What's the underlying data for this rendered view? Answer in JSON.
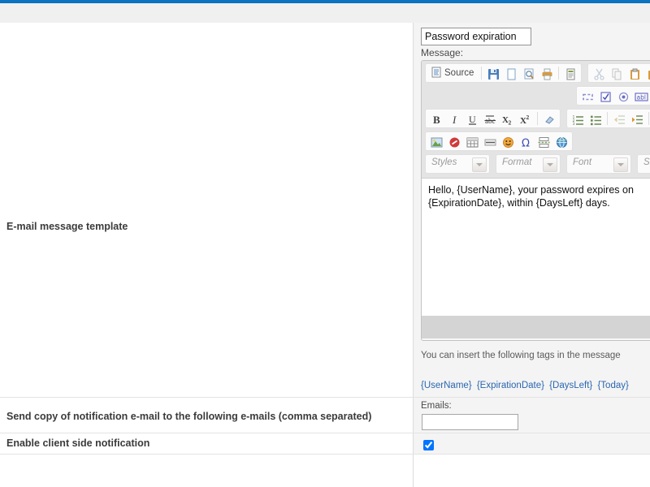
{
  "theme": {
    "accent_blue": "#0a73c2",
    "header_gray": "#f0f0f0",
    "panel_gray": "#f4f4f4",
    "link_blue": "#2a66b0",
    "label_text": "#3b3b3b"
  },
  "settings_rows": [
    {
      "label": "E-mail message template"
    },
    {
      "label": "Send copy of notification e-mail to the following e-mails (comma separated)"
    },
    {
      "label": "Enable client side notification"
    }
  ],
  "template_panel": {
    "subject_value": "Password expiration",
    "subject_placeholder": "",
    "message_label": "Message:",
    "hint": "You can insert the following tags in the message",
    "tags": [
      "{UserName}",
      "{ExpirationDate}",
      "{DaysLeft}",
      "{Today}"
    ],
    "editor": {
      "body_text": "Hello, {UserName}, your password expires on {ExpirationDate}, within {DaysLeft} days.",
      "source_label": "Source",
      "combos": [
        {
          "name": "styles",
          "label": "Styles"
        },
        {
          "name": "format",
          "label": "Format"
        },
        {
          "name": "font",
          "label": "Font"
        },
        {
          "name": "size",
          "label": "Size"
        }
      ],
      "toolbar_rows": [
        {
          "groups": [
            {
              "name": "document",
              "buttons": [
                {
                  "icon": "source-icon",
                  "label": "Source"
                },
                {
                  "icon": "save-icon",
                  "label": ""
                },
                {
                  "icon": "new-page-icon",
                  "label": ""
                },
                {
                  "icon": "preview-icon",
                  "label": ""
                },
                {
                  "icon": "print-icon",
                  "label": ""
                },
                {
                  "icon": "templates-icon",
                  "label": ""
                }
              ]
            },
            {
              "name": "clipboard",
              "buttons": [
                {
                  "icon": "cut-icon",
                  "label": ""
                },
                {
                  "icon": "copy-icon",
                  "label": ""
                },
                {
                  "icon": "paste-icon",
                  "label": ""
                },
                {
                  "icon": "paste-text-icon",
                  "label": ""
                }
              ]
            }
          ]
        },
        {
          "groups": [
            {
              "name": "forms",
              "buttons": [
                {
                  "icon": "hidden-field-icon",
                  "label": ""
                },
                {
                  "icon": "checkbox-icon",
                  "label": ""
                },
                {
                  "icon": "radio-button-icon",
                  "label": ""
                },
                {
                  "icon": "text-field-icon",
                  "label": ""
                }
              ]
            }
          ]
        },
        {
          "groups": [
            {
              "name": "basic-styles",
              "buttons": [
                {
                  "icon": "bold-icon",
                  "label": "B"
                },
                {
                  "icon": "italic-icon",
                  "label": "I"
                },
                {
                  "icon": "underline-icon",
                  "label": "U"
                },
                {
                  "icon": "strike-icon",
                  "label": "abc"
                },
                {
                  "icon": "subscript-icon",
                  "label": "X2"
                },
                {
                  "icon": "superscript-icon",
                  "label": "X2"
                },
                {
                  "icon": "remove-format-icon",
                  "label": ""
                }
              ]
            },
            {
              "name": "paragraph",
              "buttons": [
                {
                  "icon": "numbered-list-icon",
                  "label": ""
                },
                {
                  "icon": "bulleted-list-icon",
                  "label": ""
                },
                {
                  "icon": "outdent-icon",
                  "label": ""
                },
                {
                  "icon": "indent-icon",
                  "label": ""
                },
                {
                  "icon": "blockquote-icon",
                  "label": ""
                }
              ]
            }
          ]
        },
        {
          "groups": [
            {
              "name": "insert",
              "buttons": [
                {
                  "icon": "image-icon",
                  "label": ""
                },
                {
                  "icon": "flash-icon",
                  "label": ""
                },
                {
                  "icon": "table-icon",
                  "label": ""
                },
                {
                  "icon": "horizontal-rule-icon",
                  "label": ""
                },
                {
                  "icon": "smiley-icon",
                  "label": ""
                },
                {
                  "icon": "special-char-icon",
                  "label": ""
                },
                {
                  "icon": "page-break-icon",
                  "label": ""
                },
                {
                  "icon": "iframe-icon",
                  "label": ""
                }
              ]
            }
          ]
        }
      ]
    }
  },
  "emails_panel": {
    "label": "Emails:",
    "value": "",
    "placeholder": ""
  },
  "client_side_panel": {
    "checked": true
  }
}
